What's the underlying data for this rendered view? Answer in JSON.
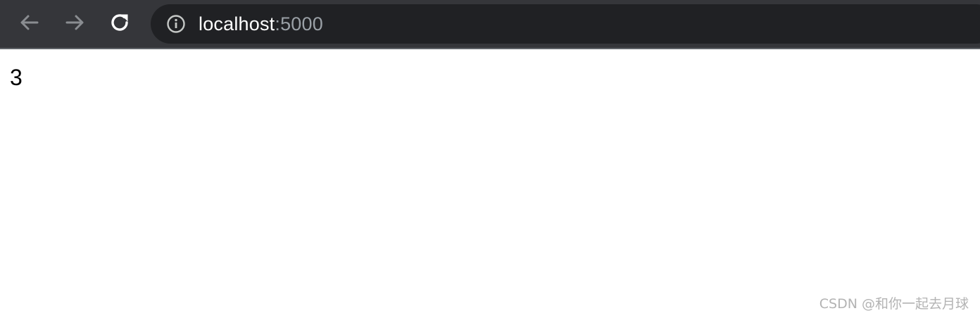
{
  "browser": {
    "url_host": "localhost",
    "url_port": ":5000",
    "icons": {
      "back": "arrow-left-icon",
      "forward": "arrow-right-icon",
      "reload": "reload-icon",
      "site_info": "info-icon"
    },
    "colors": {
      "toolbar_bg": "#35363a",
      "omnibox_bg": "#202124",
      "host_text": "#ffffff",
      "port_text": "#9aa0a6"
    }
  },
  "page": {
    "body_text": "3"
  },
  "watermark": {
    "text": "CSDN @和你一起去月球"
  }
}
